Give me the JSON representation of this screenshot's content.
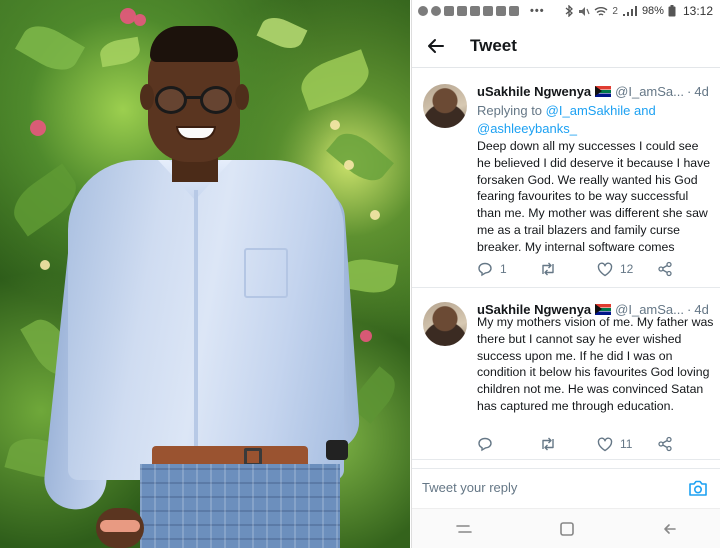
{
  "status_bar": {
    "battery": "98%",
    "time": "13:12",
    "notification_icons": [
      "sync-icon",
      "facebook-icon",
      "twitter-icon",
      "check-icon",
      "mail-icon",
      "gmail-icon",
      "mail-icon",
      "image-icon"
    ],
    "sim_indicator": "2"
  },
  "header": {
    "title": "Tweet"
  },
  "tweets": [
    {
      "author": "uSakhile Ngwenya",
      "flag": "south-africa-flag",
      "handle": "@I_amSa...",
      "separator": "·",
      "time": "4d",
      "reply_prefix": "Replying to",
      "reply_mentions": "@I_amSakhile and @ashleeybanks_",
      "text": "Deep down all my successes I could see he believed I did deserve it because I have forsaken God. We really wanted his God fearing favourites to be way successful than me. My mother was different she saw me as a trail blazers and family curse breaker. My internal software comes",
      "replies": "1",
      "retweets": "",
      "likes": "12"
    },
    {
      "author": "uSakhile Ngwenya",
      "flag": "south-africa-flag",
      "handle": "@I_amSa...",
      "separator": "·",
      "time": "4d",
      "text": "My my mothers vision of me. My father was there but I cannot say he ever wished success upon me. If he did I was on condition it below his favourites God loving children not me. He was convinced Satan has captured me through education.",
      "replies": "",
      "retweets": "",
      "likes": "11"
    }
  ],
  "reply_box": {
    "placeholder": "Tweet your reply"
  },
  "colors": {
    "link": "#1da1f2",
    "muted": "#657786",
    "text": "#14171a"
  }
}
